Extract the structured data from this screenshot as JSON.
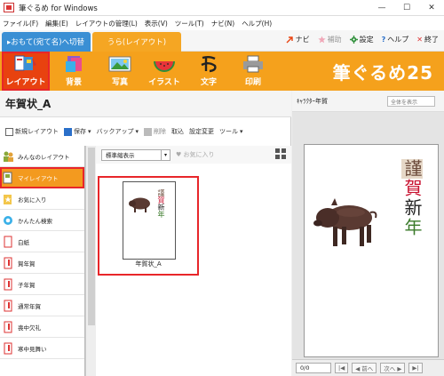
{
  "window": {
    "title": "筆ぐるめ for Windows",
    "minimize": "—",
    "maximize": "☐",
    "close": "✕"
  },
  "menu": [
    "ファイル(F)",
    "編集(E)",
    "レイアウトの管理(L)",
    "表示(V)",
    "ツール(T)",
    "ナビ(N)",
    "ヘルプ(H)"
  ],
  "tabs": {
    "front": "▸おもて(宛て名)へ切替",
    "back": "うら(レイアウト)"
  },
  "top_actions": {
    "navi": "ナビ",
    "assist": "補助",
    "settings": "設定",
    "help": "ヘルプ",
    "exit": "終了"
  },
  "modes": [
    "レイアウト",
    "背景",
    "写真",
    "イラスト",
    "文字",
    "印刷"
  ],
  "brand": "筆ぐるめ25",
  "page_title": "年賀状_A",
  "toolbar": [
    "新規レイアウト",
    "保存",
    "バックアップ",
    "削除",
    "取込",
    "設定変更",
    "ツール"
  ],
  "sidebar": [
    "みんなのレイアウト",
    "マイレイアウト",
    "お気に入り",
    "かんたん検索",
    "白紙",
    "賀年賀",
    "子年賀",
    "通常年賀",
    "喪中欠礼",
    "寒中見舞い"
  ],
  "gallery": {
    "view_select": "標準縮表示",
    "favorite_label": "お気に入り",
    "card_label": "年賀状_A"
  },
  "greeting_chars": [
    "謹",
    "賀",
    "新",
    "年"
  ],
  "right_panel": {
    "title": "ｷｬﾗｸﾀｰ年賀",
    "view_select": "全体を表示"
  },
  "page_bar": {
    "counter": "0/0",
    "prev": "◀ 前へ",
    "next": "次へ ▶"
  },
  "colors": {
    "orange": "#f5a11c",
    "selected": "#e8420f",
    "highlight": "#e8262a",
    "tab_front": "#3a8fd4"
  }
}
